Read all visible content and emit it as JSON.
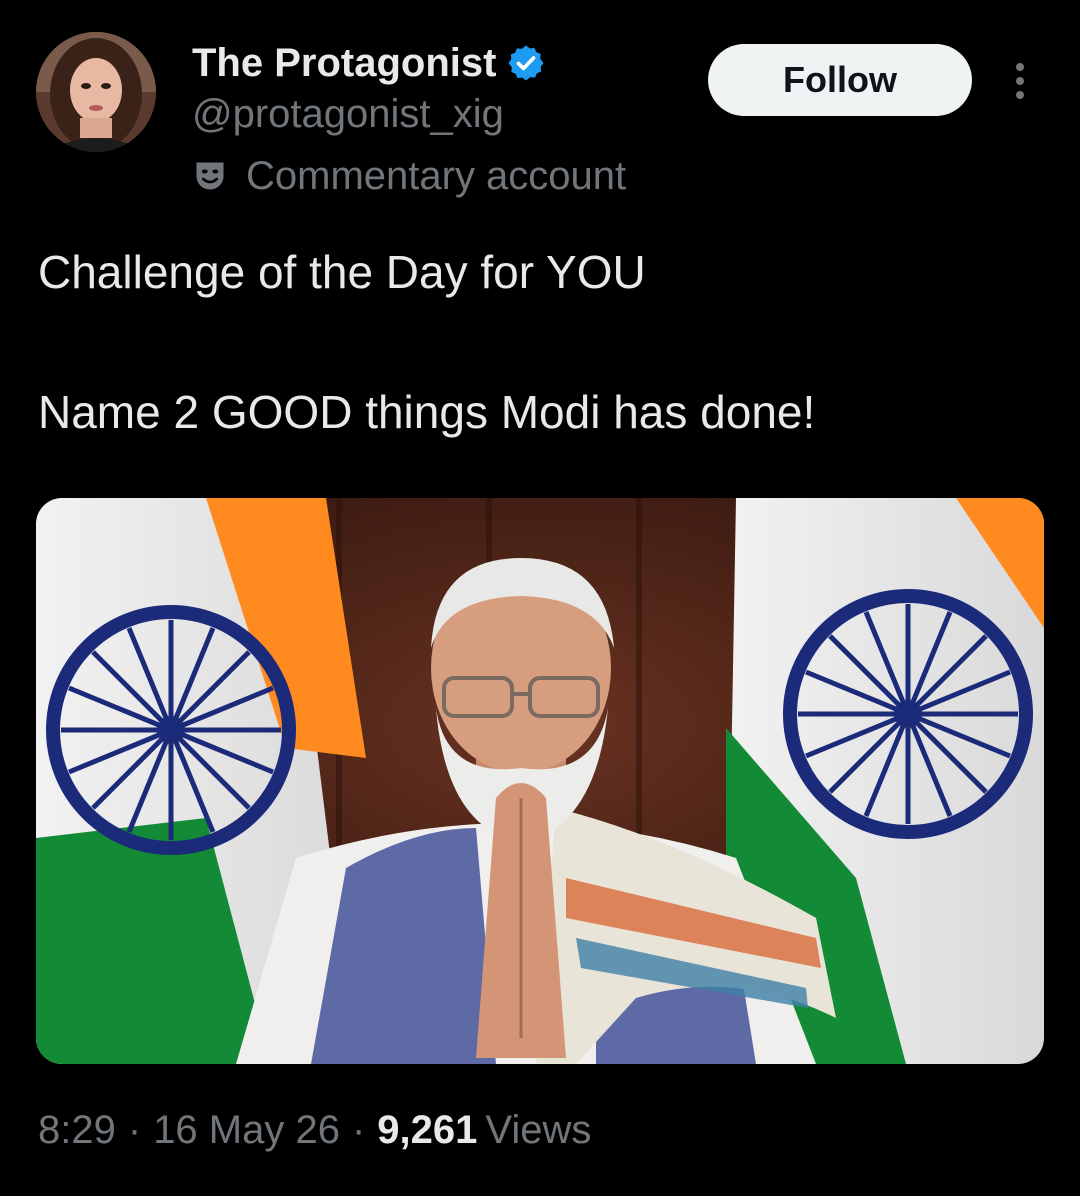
{
  "author": {
    "display_name": "The Protagonist",
    "handle": "@protagonist_xig",
    "label": "Commentary account",
    "verified_color": "#1d9bf0"
  },
  "actions": {
    "follow_label": "Follow"
  },
  "tweet": {
    "line1": "Challenge of the Day for YOU",
    "line2": "Name 2 GOOD things Modi has done!"
  },
  "meta": {
    "time": "8:29",
    "separator": "·",
    "date": "16 May 26",
    "views_count": "9,261",
    "views_label": "Views"
  },
  "colors": {
    "background": "#000000",
    "text_primary": "#e7e9ea",
    "text_secondary": "#71767b",
    "follow_bg": "#eff3f4",
    "saffron": "#ff8a1f",
    "india_green": "#138a36",
    "chakra_navy": "#1c2a7a"
  },
  "icons": {
    "verified": "verified-badge-icon",
    "label": "theater-masks-icon",
    "more": "more-dots-icon"
  }
}
